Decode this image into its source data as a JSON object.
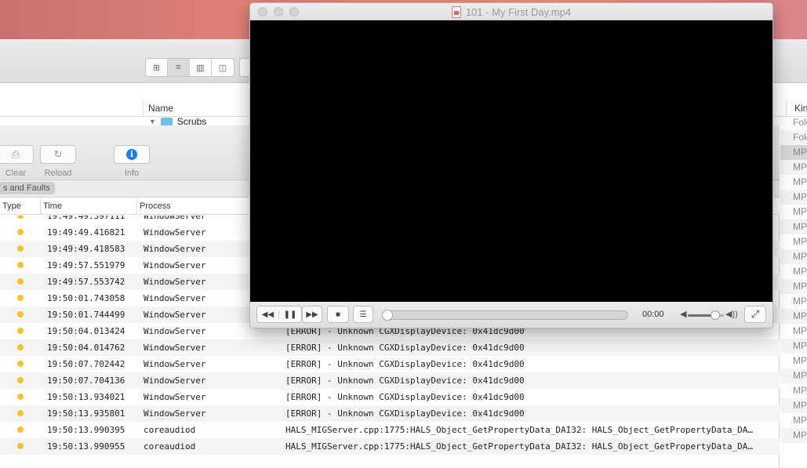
{
  "finder": {
    "column_name": "Name",
    "column_kind": "Kin",
    "folder_name": "Scrubs",
    "kind_values": [
      "Fold",
      "Fold",
      "MP",
      "MP",
      "MP",
      "MP",
      "MP",
      "MP",
      "MP",
      "MP",
      "MP",
      "MP",
      "MP",
      "MP",
      "MP",
      "MP",
      "MP",
      "MP",
      "MP",
      "MP",
      "MP",
      "MP"
    ],
    "view_modes": [
      "icon-view-icon",
      "list-view-icon",
      "column-view-icon",
      "cover-flow-icon"
    ]
  },
  "console": {
    "toolbar": {
      "clear_label": "Clear",
      "reload_label": "Reload",
      "info_label": "Info",
      "info_glyph": "i"
    },
    "filter_label": "s and Faults",
    "columns": {
      "type": "Type",
      "time": "Time",
      "process": "Process"
    },
    "partial_row_time": "19:49:49.397111",
    "partial_row_process": "WindowServer",
    "rows": [
      {
        "time": "19:49:49.416821",
        "process": "WindowServer",
        "message": ""
      },
      {
        "time": "19:49:49.418583",
        "process": "WindowServer",
        "message": ""
      },
      {
        "time": "19:49:57.551979",
        "process": "WindowServer",
        "message": ""
      },
      {
        "time": "19:49:57.553742",
        "process": "WindowServer",
        "message": ""
      },
      {
        "time": "19:50:01.743058",
        "process": "WindowServer",
        "message": ""
      },
      {
        "time": "19:50:01.744499",
        "process": "WindowServer",
        "message": ""
      },
      {
        "time": "19:50:04.013424",
        "process": "WindowServer",
        "message": "[ERROR] - Unknown CGXDisplayDevice: 0x41dc9d00"
      },
      {
        "time": "19:50:04.014762",
        "process": "WindowServer",
        "message": "[ERROR] - Unknown CGXDisplayDevice: 0x41dc9d00"
      },
      {
        "time": "19:50:07.702442",
        "process": "WindowServer",
        "message": "[ERROR] - Unknown CGXDisplayDevice: 0x41dc9d00"
      },
      {
        "time": "19:50:07.704136",
        "process": "WindowServer",
        "message": "[ERROR] - Unknown CGXDisplayDevice: 0x41dc9d00"
      },
      {
        "time": "19:50:13.934021",
        "process": "WindowServer",
        "message": "[ERROR] - Unknown CGXDisplayDevice: 0x41dc9d00"
      },
      {
        "time": "19:50:13.935801",
        "process": "WindowServer",
        "message": "[ERROR] - Unknown CGXDisplayDevice: 0x41dc9d00"
      },
      {
        "time": "19:50:13.990395",
        "process": "coreaudiod",
        "message": "HALS_MIGServer.cpp:1775:HALS_Object_GetPropertyData_DAI32:  HALS_Object_GetPropertyData_DA…"
      },
      {
        "time": "19:50:13.990955",
        "process": "coreaudiod",
        "message": "HALS_MIGServer.cpp:1775:HALS_Object_GetPropertyData_DAI32:  HALS_Object_GetPropertyData_DA…"
      }
    ]
  },
  "player": {
    "title": "101 - My First Day.mp4",
    "elapsed": "00:00",
    "progress": 0.0,
    "volume": 0.75,
    "icons": {
      "rewind": "◀◀",
      "pause": "❚❚",
      "forward": "▶▶",
      "stop": "■",
      "playlist": "☰",
      "vol_low": "◀",
      "vol_high": "◀))",
      "fullscreen": "⤢"
    }
  }
}
